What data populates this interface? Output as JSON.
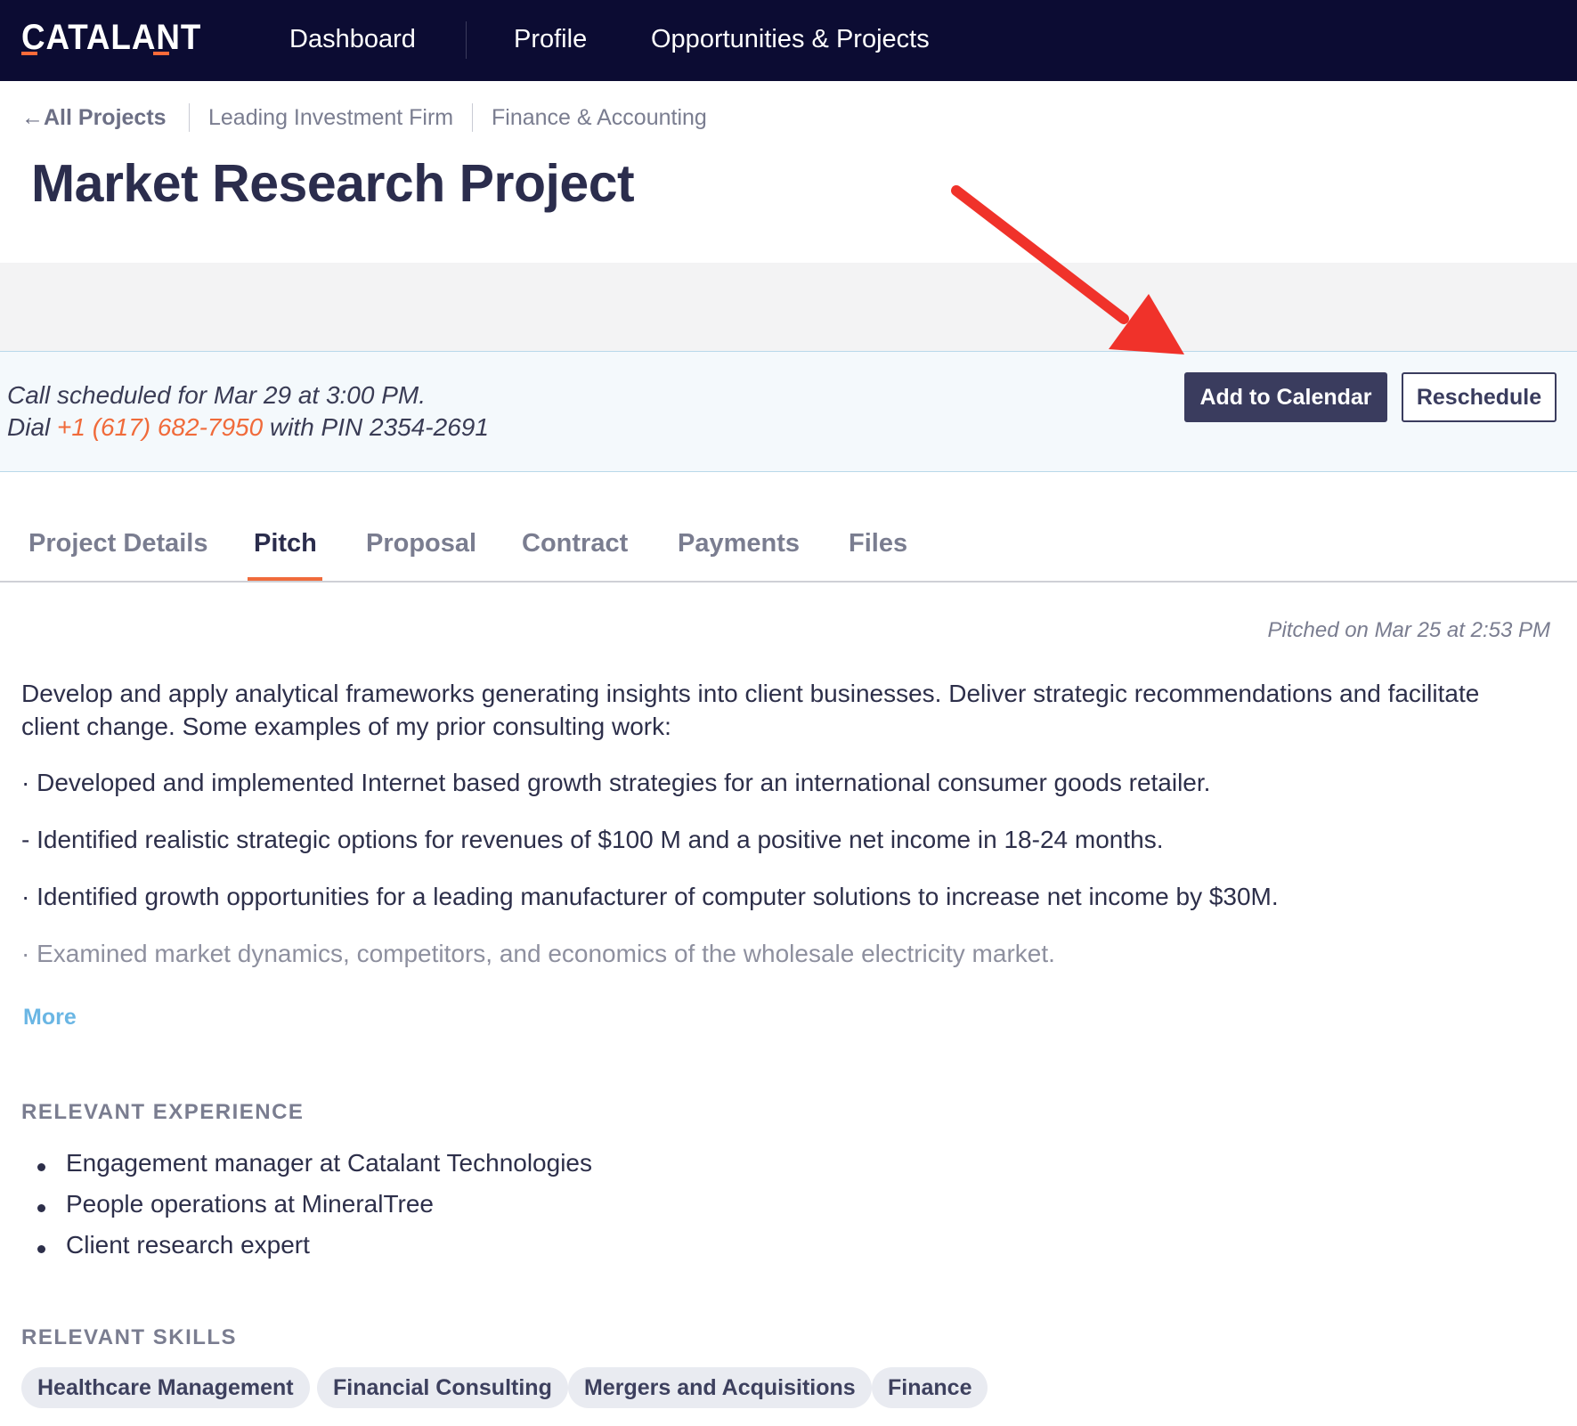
{
  "nav": {
    "logo": "CATALANT",
    "items": [
      "Dashboard",
      "Profile",
      "Opportunities & Projects"
    ]
  },
  "breadcrumb": {
    "back": "All Projects",
    "client": "Leading Investment Firm",
    "category": "Finance & Accounting"
  },
  "page_title": "Market Research Project",
  "call": {
    "line1": "Call scheduled for Mar 29 at 3:00 PM.",
    "dial_prefix": "Dial ",
    "phone": "+1 (617) 682-7950",
    "pin_text": " with PIN 2354-2691",
    "add_calendar": "Add to Calendar",
    "reschedule": "Reschedule"
  },
  "tabs": [
    "Project Details",
    "Pitch",
    "Proposal",
    "Contract",
    "Payments",
    "Files"
  ],
  "active_tab": "Pitch",
  "pitch": {
    "pitched_on": "Pitched on Mar 25 at 2:53 PM",
    "intro": "Develop and apply analytical frameworks generating insights into client businesses. Deliver strategic recommendations and facilitate client change. Some examples of my prior consulting work:",
    "points": [
      "· Developed and implemented Internet based growth strategies for an international consumer goods retailer.",
      "- Identified realistic strategic options for revenues of $100 M and a positive net income in 18-24 months.",
      "· Identified growth opportunities for a leading manufacturer of computer solutions to increase net income by $30M.",
      "· Examined market dynamics, competitors, and economics of the wholesale electricity market."
    ],
    "more": "More"
  },
  "experience": {
    "heading": "RELEVANT EXPERIENCE",
    "items": [
      "Engagement manager at Catalant Technologies",
      "People operations at MineralTree",
      "Client research expert"
    ]
  },
  "skills": {
    "heading": "RELEVANT SKILLS",
    "items": [
      "Healthcare Management",
      "Financial Consulting",
      "Mergers and Acquisitions",
      "Finance"
    ]
  },
  "colors": {
    "nav_bg": "#0c0c33",
    "accent": "#f06b3b",
    "primary_button": "#3a3c5e",
    "link": "#6ab6e4",
    "annotation_arrow": "#f0322a"
  }
}
